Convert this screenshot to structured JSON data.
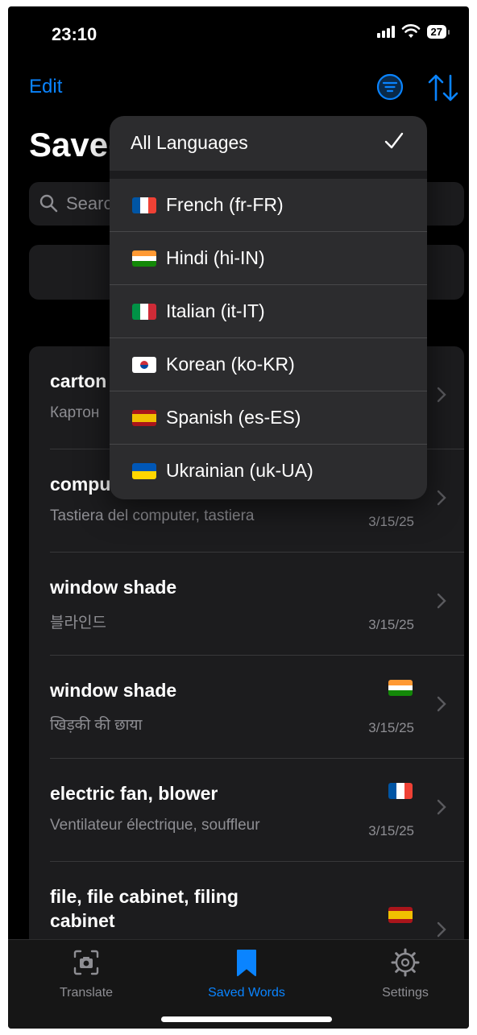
{
  "status": {
    "time": "23:10",
    "battery": "27"
  },
  "nav": {
    "edit_label": "Edit"
  },
  "page": {
    "title": "Saved Words"
  },
  "search": {
    "placeholder": "Search"
  },
  "dropdown": {
    "all_label": "All Languages",
    "items": [
      {
        "flag": "fr",
        "label": "French (fr-FR)"
      },
      {
        "flag": "in",
        "label": "Hindi (hi-IN)"
      },
      {
        "flag": "it",
        "label": "Italian (it-IT)"
      },
      {
        "flag": "kr",
        "label": "Korean (ko-KR)"
      },
      {
        "flag": "es",
        "label": "Spanish (es-ES)"
      },
      {
        "flag": "ua",
        "label": "Ukrainian (uk-UA)"
      }
    ]
  },
  "words": [
    {
      "term": "carton",
      "translation": "Картон",
      "flag": "ua",
      "date": ""
    },
    {
      "term": "compu",
      "translation": "Tastiera del computer, tastiera",
      "flag": "it",
      "date": "3/15/25"
    },
    {
      "term": "window shade",
      "translation": "블라인드",
      "flag": "kr",
      "date": "3/15/25"
    },
    {
      "term": "window shade",
      "translation": "खिड़की की छाया",
      "flag": "in",
      "date": "3/15/25"
    },
    {
      "term": "electric fan, blower",
      "translation": "Ventilateur électrique, souffleur",
      "flag": "fr",
      "date": "3/15/25"
    },
    {
      "term": "file, file cabinet, filing cabinet",
      "translation": "",
      "flag": "es",
      "date": ""
    }
  ],
  "tabs": [
    {
      "label": "Translate",
      "icon": "camera-icon",
      "color": "#8e8e93"
    },
    {
      "label": "Saved Words",
      "icon": "bookmark-icon",
      "color": "#0a84ff"
    },
    {
      "label": "Settings",
      "icon": "gear-icon",
      "color": "#8e8e93"
    }
  ]
}
